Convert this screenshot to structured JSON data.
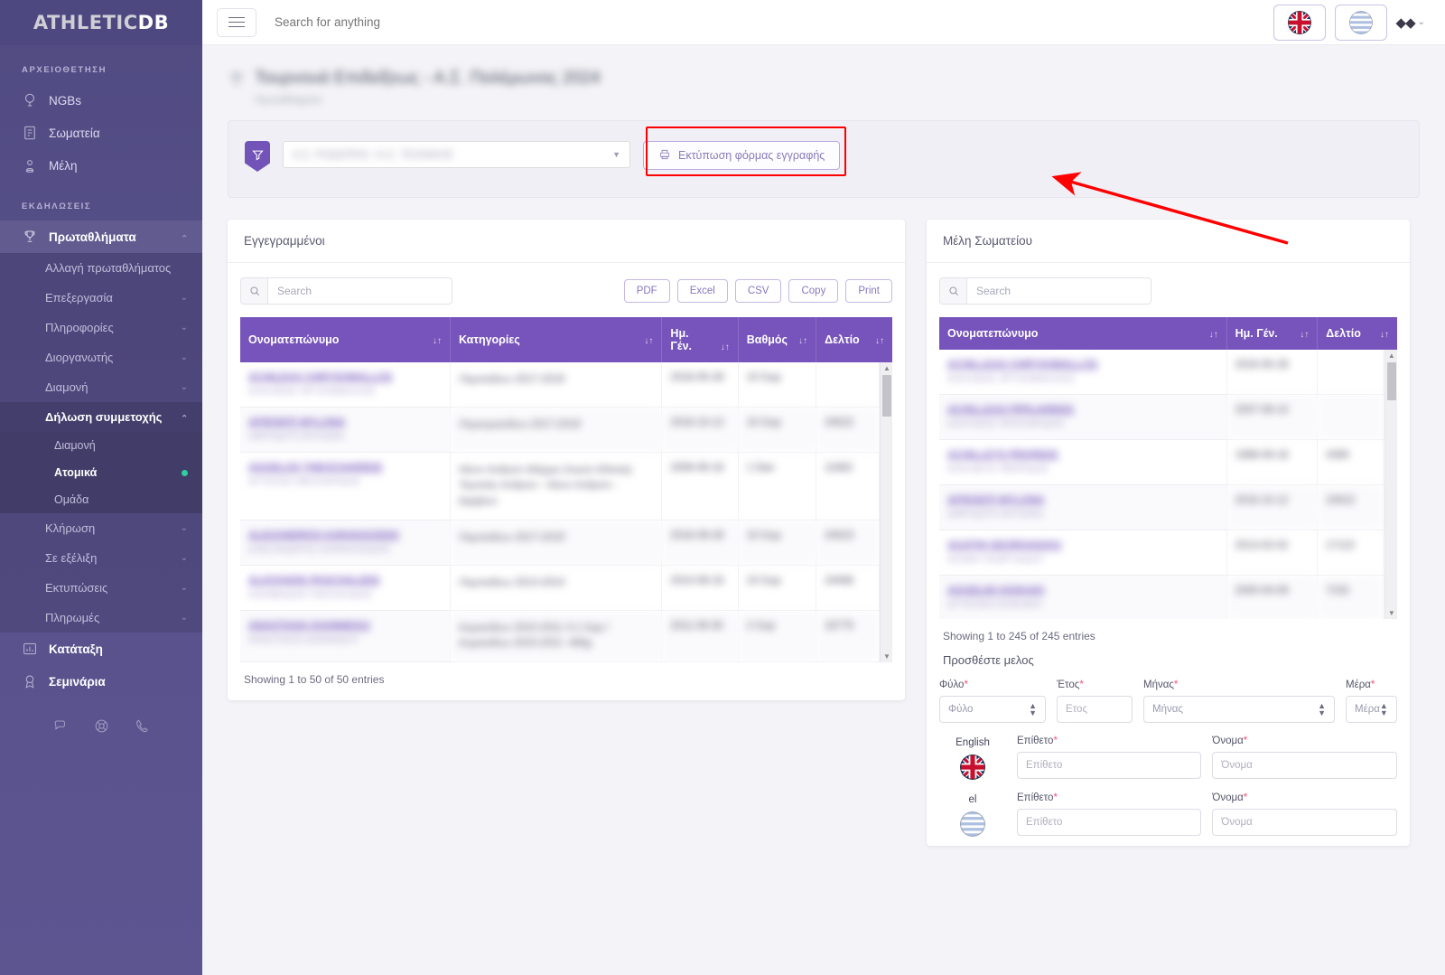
{
  "brand": {
    "part1": "ATHLETIC",
    "part2": "DB"
  },
  "sidebar": {
    "section_archive": "ΑΡΧΕΙΟΘΕΤΗΣΗ",
    "archive_items": [
      {
        "label": "NGBs",
        "icon": "globe-icon"
      },
      {
        "label": "Σωματεία",
        "icon": "building-icon"
      },
      {
        "label": "Μέλη",
        "icon": "user-pin-icon"
      }
    ],
    "section_events": "ΕΚΔΗΛΩΣΕΙΣ",
    "championships": {
      "label": "Πρωταθλήματα",
      "icon": "trophy-icon"
    },
    "championship_subitems": [
      {
        "label": "Αλλαγή πρωταθλήματος",
        "expandable": false
      },
      {
        "label": "Επεξεργασία",
        "expandable": true
      },
      {
        "label": "Πληροφορίες",
        "expandable": true
      },
      {
        "label": "Διοργανωτής",
        "expandable": true
      },
      {
        "label": "Διαμονή",
        "expandable": true
      },
      {
        "label": "Δήλωση συμμετοχής",
        "expandable": true,
        "expanded": true
      }
    ],
    "participation_subitems": [
      {
        "label": "Διαμονή",
        "current": false
      },
      {
        "label": "Ατομικά",
        "current": true
      },
      {
        "label": "Ομάδα",
        "current": false
      }
    ],
    "championship_subitems_after": [
      {
        "label": "Κλήρωση",
        "expandable": true
      },
      {
        "label": "Σε εξέλιξη",
        "expandable": true
      },
      {
        "label": "Εκτυπώσεις",
        "expandable": true
      },
      {
        "label": "Πληρωμές",
        "expandable": true
      }
    ],
    "bottom_items": [
      {
        "label": "Κατάταξη",
        "icon": "chart-icon"
      },
      {
        "label": "Σεμινάρια",
        "icon": "award-icon"
      }
    ],
    "footer_icons": [
      "chat-icon",
      "lifebuoy-icon",
      "phone-icon"
    ]
  },
  "topbar": {
    "menu_toggle": "hamburger-icon",
    "search_placeholder": "Search for anything",
    "lang_en": "english-flag",
    "lang_el": "greek-flag",
    "user_glyph": "◆◆",
    "user_chevron": "⌄"
  },
  "page": {
    "title": "Τουρνουά Επιδείξεως - Α.Σ. Πολέμωνος 2024",
    "subtitle": "Πρωταθλήματα",
    "title_blurred": true
  },
  "filter": {
    "icon": "filter-icon",
    "club_select_value": "Α.Σ. ΡΟΔΟΠΗΣ / Α.Σ. ΤΕΧΝΙΚΗΣ",
    "print_button": "Εκτύπωση φόρμας εγγραφής",
    "print_icon": "printer-icon",
    "annotation_color": "#ff0000"
  },
  "left_card": {
    "title": "Εγγεγραμμένοι",
    "search_placeholder": "Search",
    "search_icon": "search-icon",
    "export_buttons": [
      "PDF",
      "Excel",
      "CSV",
      "Copy",
      "Print"
    ],
    "columns": [
      {
        "label": "Ονοματεπώνυμο",
        "sort": "↓↑"
      },
      {
        "label": "Κατηγορίες",
        "sort": "↓↑"
      },
      {
        "label": "Ημ. Γέν.",
        "sort": "↓↑"
      },
      {
        "label": "Βαθμός",
        "sort": "↓↑"
      },
      {
        "label": "Δελτίο",
        "sort": "↓↑"
      }
    ],
    "rows": [
      {
        "name_en": "ACHILEAS CHRYSOMALLOS",
        "name_el": "ΑΧΙΛΛΕΑΣ ΧΡΥΣΟΜΑΛΛΟΣ",
        "category": "Παμπαίδων 2017-2018",
        "birth": "2016-05-28",
        "grade": "10 Gup",
        "card": ""
      },
      {
        "name_en": "AFRODITI MYLONA",
        "name_el": "ΑΦΡΟΔΙΤΗ ΜΥΛΩΝΑ",
        "category": "Παγκορασίδων 2017-2018",
        "birth": "2016-10-12",
        "grade": "10 Gup",
        "card": "24522"
      },
      {
        "name_en": "AGGELOS THEOCHARIDIS",
        "name_el": "ΑΓΓΕΛΟΣ ΘΕΟΧΑΡΙΔΗΣ",
        "category": "Νέων Ανδρών Μάχιμο Ζυγών Εθνικής Τεχνικής Ανδρών - Νέων Ανδρών - Εφήβων",
        "birth": "2006-06-16",
        "grade": "1 Dan",
        "card": "11662"
      },
      {
        "name_en": "ALEXANDROS KARAKIOZIDIS",
        "name_el": "ΑΛΕΞΑΝΔΡΟΣ ΚΑΡΑΚΙΟΖΙΔΗΣ",
        "category": "Παμπαίδων 2017-2018",
        "birth": "2016-09-28",
        "grade": "10 Gup",
        "card": "24523"
      },
      {
        "name_en": "ALKIVIADIS PASCHALIDIS",
        "name_el": "ΑΛΚΙΒΙΑΔΗΣ ΠΑΣΧΑΛΙΔΗΣ",
        "category": "Παμπαίδων 2013-2014",
        "birth": "2014-08-16",
        "grade": "10 Gup",
        "card": "24466"
      },
      {
        "name_en": "ANASTASIA IOANNIDOU",
        "name_el": "ΑΝΑΣΤΑΣΙΑ ΙΩΑΝΝΙΔΟΥ",
        "category": "Κορασίδων 2010-2011 3-1 Gup / Κορασίδων 2010-2011 -40kg",
        "birth": "2011-09-30",
        "grade": "2 Gup",
        "card": "16775"
      }
    ],
    "showing": "Showing 1 to 50 of 50 entries"
  },
  "right_card": {
    "title": "Μέλη Σωματείου",
    "search_placeholder": "Search",
    "search_icon": "search-icon",
    "columns": [
      {
        "label": "Ονοματεπώνυμο",
        "sort": "↓↑"
      },
      {
        "label": "Ημ. Γέν.",
        "sort": "↓↑"
      },
      {
        "label": "Δελτίο",
        "sort": "↓↑"
      }
    ],
    "rows": [
      {
        "name_en": "ACHILLEAS CHRYSOMALLOS",
        "name_el": "ΑΧΙΛΛΕΑΣ ΧΡΥΣΟΜΑΛΛΟΣ",
        "birth": "2016-05-28",
        "card": ""
      },
      {
        "name_en": "ACHILLEAS PIPILIARIDIS",
        "name_el": "ΑΧΙΛΛΕΑΣ ΠΙΠΙΛΙΑΡΙΔΗΣ",
        "birth": "2007-08-10",
        "card": ""
      },
      {
        "name_en": "ACHILLEYS PEKRIDIS",
        "name_el": "ΑΧΙΛΛΕΥΣ ΠΕΚΡΙΔΗΣ",
        "birth": "1998-09-18",
        "card": "4390"
      },
      {
        "name_en": "AFRODITI MYLONA",
        "name_el": "ΑΦΡΟΔΙΤΗ ΜΥΛΩΝΑ",
        "birth": "2016-10-12",
        "card": "24522"
      },
      {
        "name_en": "AGATHI GEORGIADOU",
        "name_el": "ΑΓΑΘΗ ΓΕΩΡΓΙΑΔΟΥ",
        "birth": "2013-02-02",
        "card": "17122"
      },
      {
        "name_en": "AGGELIKI KIOKAKI",
        "name_el": "ΑΓΓΕΛΙΚΗ ΚΙΟΚΑΚΗ",
        "birth": "2000-04-09",
        "card": "7232"
      }
    ],
    "showing": "Showing 1 to 245 of 245 entries",
    "add_member_title": "Προσθέστε μελος",
    "form": {
      "gender": {
        "label": "Φύλο",
        "required": true,
        "placeholder": "Φύλο",
        "type": "select"
      },
      "year": {
        "label": "Έτος",
        "required": true,
        "placeholder": "Ετος",
        "type": "text"
      },
      "month": {
        "label": "Μήνας",
        "required": true,
        "placeholder": "Μήνας",
        "type": "select"
      },
      "day": {
        "label": "Μέρα",
        "required": true,
        "placeholder": "Μέρα",
        "type": "select"
      },
      "lang_rows": [
        {
          "lang_label": "English",
          "flag": "english-flag",
          "surname": {
            "label": "Επίθετο",
            "required": true,
            "placeholder": "Επίθετο"
          },
          "firstname": {
            "label": "Όνομα",
            "required": true,
            "placeholder": "Όνομα"
          }
        },
        {
          "lang_label": "el",
          "flag": "greek-flag",
          "surname": {
            "label": "Επίθετο",
            "required": true,
            "placeholder": "Επίθετο"
          },
          "firstname": {
            "label": "Όνομα",
            "required": true,
            "placeholder": "Όνομα"
          }
        }
      ]
    }
  },
  "colors": {
    "sidebar": "#57508a",
    "accent_purple": "#7754bb",
    "annotation_red": "#ff0000",
    "active_dot": "#2ecfa0"
  }
}
